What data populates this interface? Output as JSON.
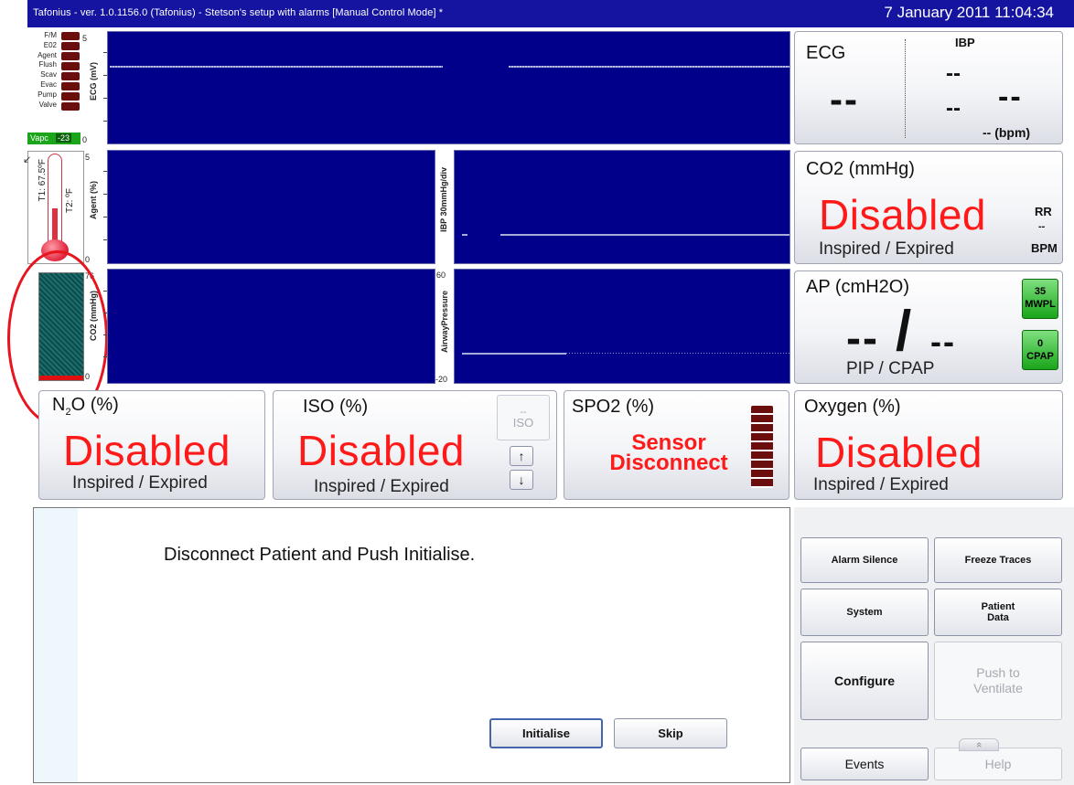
{
  "window": {
    "title": "Tafonius - ver. 1.0.1156.0 (Tafonius) - Stetson's setup with alarms [Manual Control Mode] *",
    "datetime": "7 January 2011 11:04:34"
  },
  "status_indicators": [
    "F/M",
    "E02",
    "Agent",
    "Flush",
    "Scav",
    "Evac",
    "Pump",
    "Valve"
  ],
  "vaporizer": {
    "label": "Vapc",
    "value": "-23"
  },
  "thermometer": {
    "t1": "T1: 67.5ºF",
    "t2": "T2: ºF"
  },
  "co2_bar": {
    "max": "76",
    "min": "0"
  },
  "plots": {
    "ecg": {
      "ylabel": "ECG (mV)",
      "max": "5",
      "min": "0"
    },
    "agent": {
      "ylabel": "Agent (%)",
      "max": "5",
      "min": "0"
    },
    "ibp": {
      "ylabel": "IBP 30mmHg/div"
    },
    "co2": {
      "ylabel": "CO2 (mmHg)"
    },
    "airway": {
      "ylabel": "AirwayPressure",
      "max": "60",
      "min": "-20"
    }
  },
  "panels": {
    "ecg": {
      "title": "ECG",
      "value": "--",
      "bpm": "-- (bpm)"
    },
    "ibp": {
      "title": "IBP",
      "sys": "--",
      "mean": "--",
      "dia": "--"
    },
    "co2": {
      "title": "CO2 (mmHg)",
      "value": "Disabled",
      "sub": "Inspired / Expired",
      "rr_label": "RR",
      "rr_value": "--",
      "rr_unit": "BPM"
    },
    "ap": {
      "title": "AP (cmH2O)",
      "pip": "--",
      "slash": "/",
      "cpap": "--",
      "sub": "PIP / CPAP",
      "mwpl_value": "35",
      "mwpl_label": "MWPL",
      "cpap_value": "0",
      "cpap_label": "CPAP"
    },
    "n2o": {
      "title_pre": "N",
      "title_sub": "2",
      "title_post": "O (%)",
      "value": "Disabled",
      "sub": "Inspired / Expired"
    },
    "iso": {
      "title": "ISO (%)",
      "value": "Disabled",
      "sub": "Inspired / Expired",
      "selector_value": "--",
      "selector_label": "ISO",
      "up": "↑",
      "down": "↓"
    },
    "spo2": {
      "title": "SPO2 (%)",
      "value_line1": "Sensor",
      "value_line2": "Disconnect"
    },
    "oxygen": {
      "title": "Oxygen (%)",
      "value": "Disabled",
      "sub": "Inspired / Expired"
    }
  },
  "dialog": {
    "message": "Disconnect Patient and Push Initialise.",
    "initialise_label": "Initialise",
    "skip_label": "Skip"
  },
  "controls": {
    "alarm_silence": "Alarm Silence",
    "freeze_traces": "Freeze Traces",
    "system": "System",
    "patient_data_1": "Patient",
    "patient_data_2": "Data",
    "configure": "Configure",
    "push_ventilate_1": "Push to",
    "push_ventilate_2": "Ventilate",
    "events": "Events",
    "help": "Help",
    "help_chevron": "«"
  },
  "colors": {
    "alarm_red": "#ff1a1a",
    "plot_bg": "#00008a",
    "titlebar": "#1414a0",
    "green_button": "#22aa22"
  }
}
